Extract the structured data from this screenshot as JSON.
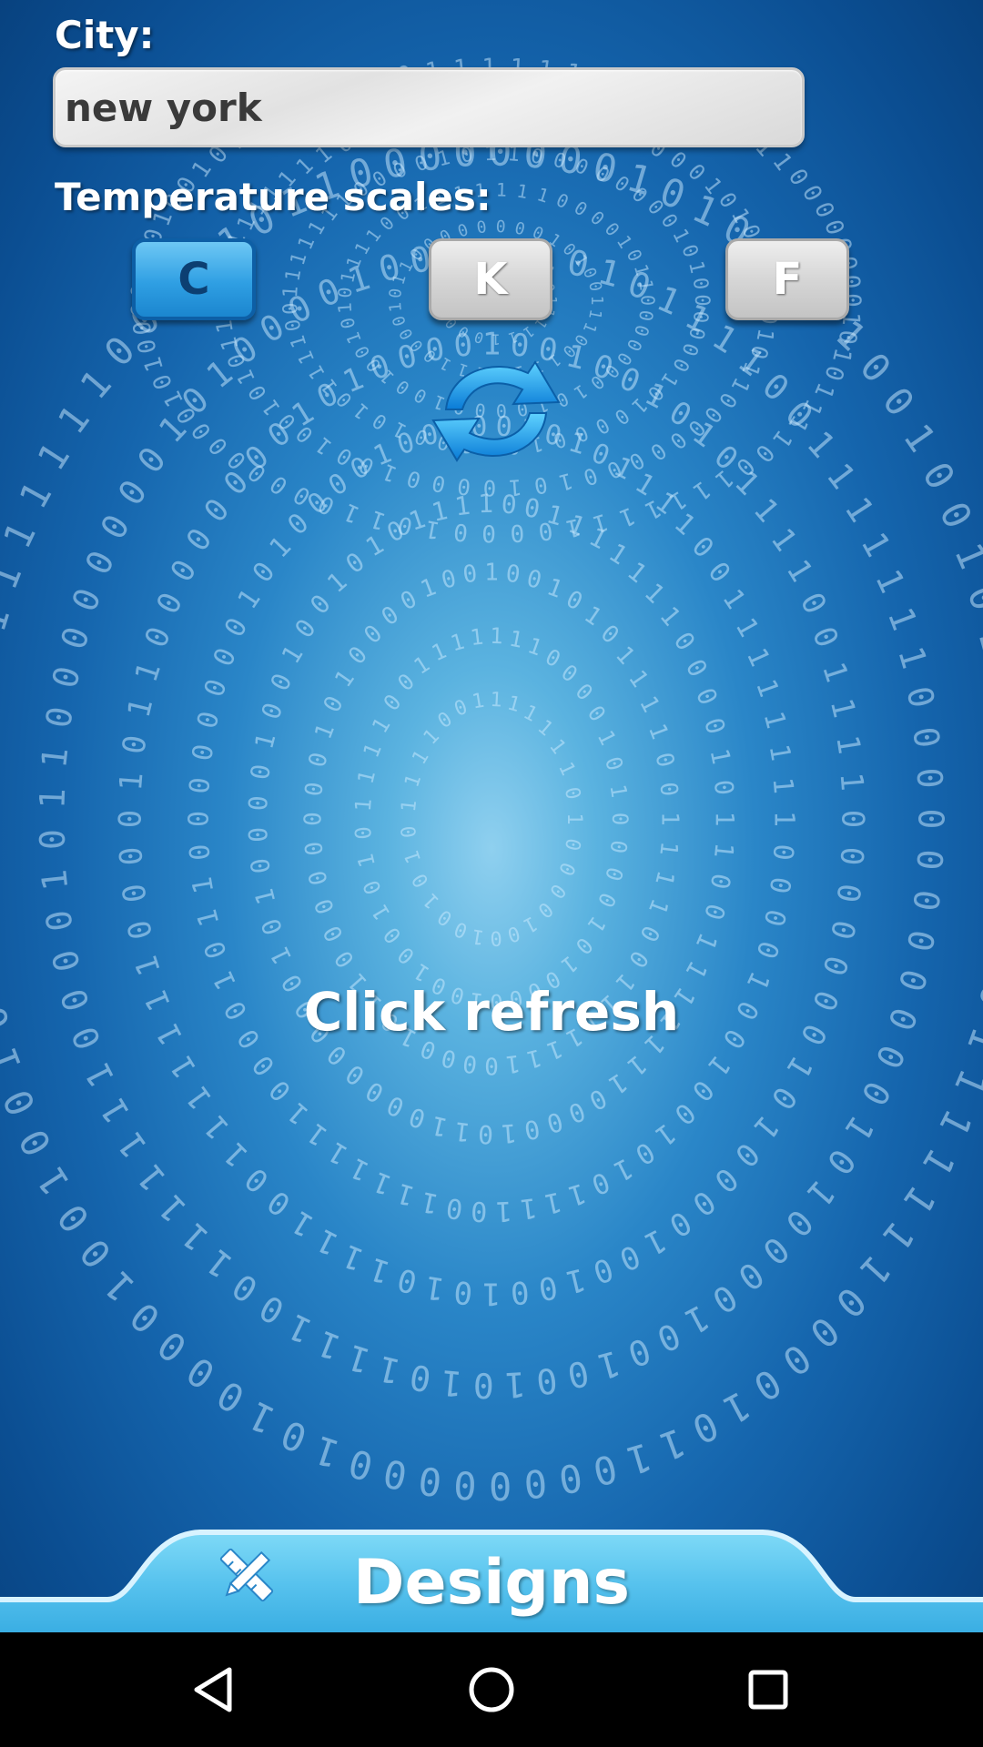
{
  "city": {
    "label": "City:",
    "value": "new york"
  },
  "scales": {
    "label": "Temperature scales:",
    "options": [
      "C",
      "K",
      "F"
    ],
    "selected": "C"
  },
  "refresh": {
    "icon": "refresh-icon"
  },
  "status": {
    "text": "Click refresh"
  },
  "bottom_tab": {
    "label": "Designs",
    "icon": "pencil-ruler-icon"
  },
  "nav": {
    "back_icon": "back-triangle-icon",
    "home_icon": "home-circle-icon",
    "recent_icon": "recent-square-icon"
  },
  "colors": {
    "background": "#1565ad",
    "active_scale": "#2f9fe3",
    "inactive_scale": "#d6d6d6",
    "bottom_bar": "#5cc6ee"
  }
}
